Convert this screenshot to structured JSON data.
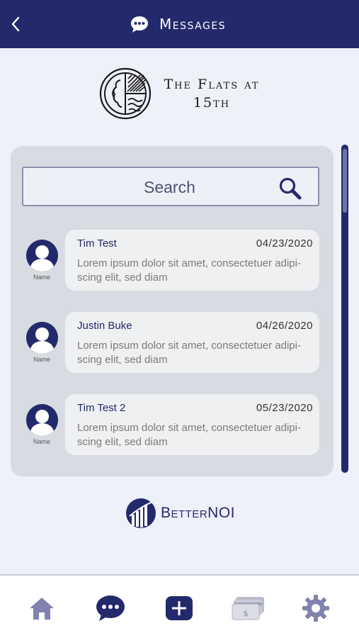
{
  "header": {
    "title": "Messages"
  },
  "brand": {
    "line1": "The Flats at",
    "line2": "15th"
  },
  "search": {
    "placeholder": "Search"
  },
  "messages": [
    {
      "name": "Tim Test",
      "date": "04/23/2020",
      "body": "Lorem ipsum dolor sit amet, consectetuer adipi-scing elit, sed diam",
      "avatar_label": "Name"
    },
    {
      "name": "Justin Buke",
      "date": "04/26/2020",
      "body": "Lorem ipsum dolor sit amet, consectetuer adipi-scing elit, sed diam",
      "avatar_label": "Name"
    },
    {
      "name": "Tim Test 2",
      "date": "05/23/2020",
      "body": "Lorem ipsum dolor sit amet, consectetuer adipi-scing elit, sed diam",
      "avatar_label": "Name"
    }
  ],
  "footer": {
    "brand": "BetterNOI"
  },
  "nav": [
    {
      "icon": "home-icon"
    },
    {
      "icon": "messages-icon",
      "active": true
    },
    {
      "icon": "add-icon",
      "active": true
    },
    {
      "icon": "payments-icon"
    },
    {
      "icon": "settings-icon"
    }
  ],
  "colors": {
    "primary": "#232a6b",
    "background": "#eef0fa",
    "panel": "#d8dbe1",
    "inactive_icon": "#8083ad"
  }
}
